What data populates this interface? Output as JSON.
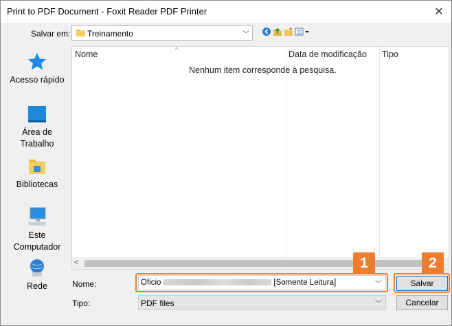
{
  "window": {
    "title": "Print to PDF Document - Foxit Reader PDF Printer",
    "close_glyph": "✕"
  },
  "save_in": {
    "label": "Salvar em:",
    "value": "Treinamento"
  },
  "toolbar": {
    "icons": [
      "back-icon",
      "up-folder-icon",
      "new-folder-icon",
      "view-menu-icon"
    ]
  },
  "places": [
    {
      "label": "Acesso rápido",
      "icon": "star-icon"
    },
    {
      "label": "Área de\nTrabalho",
      "icon": "desktop-icon"
    },
    {
      "label": "Bibliotecas",
      "icon": "libraries-icon"
    },
    {
      "label": "Este\nComputador",
      "icon": "computer-icon"
    },
    {
      "label": "Rede",
      "icon": "network-icon"
    }
  ],
  "file_list": {
    "columns": [
      "Nome",
      "Data de modificação",
      "Tipo"
    ],
    "empty_message": "Nenhum item corresponde à pesquisa."
  },
  "file_name": {
    "label": "Nome:",
    "prefix": "Oficio",
    "suffix": "[Somente Leitura]"
  },
  "file_type": {
    "label": "Tipo:",
    "value": "PDF files"
  },
  "buttons": {
    "save": "Salvar",
    "cancel": "Cancelar"
  },
  "callouts": [
    "1",
    "2"
  ],
  "colors": {
    "accent": "#ed7d31",
    "focus": "#0078d7",
    "star": "#1e8ae6"
  }
}
